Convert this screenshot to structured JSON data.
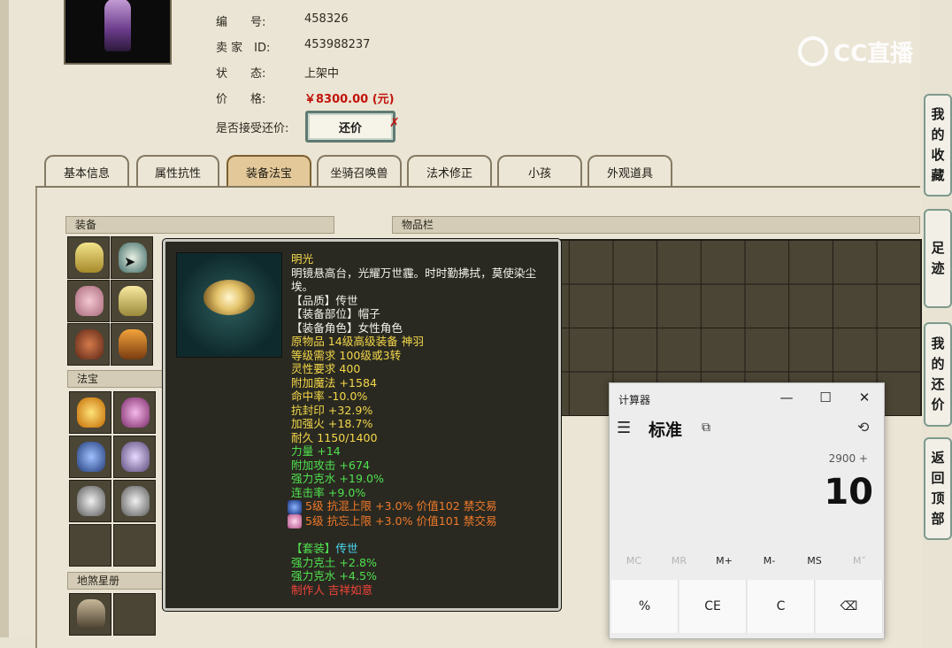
{
  "listing": {
    "rows": [
      {
        "label": "编　　号:",
        "value": "458326"
      },
      {
        "label": "卖 家　ID:",
        "value": "453988237"
      },
      {
        "label": "状　　态:",
        "value": "上架中"
      },
      {
        "label": "价　　格:",
        "value": "￥8300.00 (元)"
      }
    ],
    "counter_offer_label": "是否接受还价:",
    "counter_offer_button": "还价",
    "counter_offer_x": "✗"
  },
  "watermark": {
    "text": "CC直播"
  },
  "tabs": [
    {
      "label": "基本信息",
      "active": false
    },
    {
      "label": "属性抗性",
      "active": false
    },
    {
      "label": "装备法宝",
      "active": true
    },
    {
      "label": "坐骑召唤兽",
      "active": false
    },
    {
      "label": "法术修正",
      "active": false
    },
    {
      "label": "小孩",
      "active": false
    },
    {
      "label": "外观道具",
      "active": false
    }
  ],
  "sections": {
    "equipment": "装备",
    "treasure": "法宝",
    "star_book": "地煞星册",
    "inventory": "物品栏"
  },
  "tooltip": {
    "name": "明光",
    "desc_1": "明镜悬高台，光耀万世霾。时时勤拂拭，莫使染尘",
    "desc_2": "埃。",
    "quality": "【品质】传世",
    "slot": "【装备部位】帽子",
    "role": "【装备角色】女性角色",
    "origin": "原物品 14级高级装备 神羽",
    "level_req": "等级需求 100级或3转",
    "spirit_req": "灵性要求 400",
    "stats_yellow": [
      "附加魔法 +1584",
      "命中率 -10.0%",
      "抗封印 +32.9%",
      "加强火 +18.7%",
      "耐久 1150/1400"
    ],
    "stats_green": [
      "力量 +14",
      "附加攻击 +674",
      "强力克水 +19.0%",
      "连击率 +9.0%"
    ],
    "gems": [
      "5级 抗混上限 +3.0% 价值102 禁交易",
      "5级 抗忘上限 +3.0% 价值101 禁交易"
    ],
    "set_label": "【套装】",
    "set_value": "传世",
    "set_stats": [
      "强力克土 +2.8%",
      "强力克水 +4.5%"
    ],
    "maker": "制作人 吉祥如意"
  },
  "side_buttons": [
    {
      "label": [
        "我",
        "的",
        "收",
        "藏"
      ]
    },
    {
      "label": [
        "足",
        "迹"
      ]
    },
    {
      "label": [
        "我",
        "的",
        "还",
        "价"
      ]
    },
    {
      "label": [
        "返",
        "回",
        "顶",
        "部"
      ]
    }
  ],
  "calculator": {
    "title": "计算器",
    "minimize": "—",
    "maximize": "☐",
    "close": "✕",
    "menu_icon": "☰",
    "mode": "标准",
    "keep_on_top_icon": "⧉",
    "history_icon": "⟲",
    "expression": "2900 +",
    "display": "10",
    "memory": [
      "MC",
      "MR",
      "M+",
      "M-",
      "MS",
      "M˅"
    ],
    "memory_disabled": [
      true,
      true,
      false,
      false,
      false,
      true
    ],
    "keys": [
      "%",
      "CE",
      "C",
      "⌫"
    ]
  },
  "colors": {
    "price": "#c0140c",
    "active_tab": "#e3c99a",
    "tooltip_bg": "#2a2921"
  }
}
